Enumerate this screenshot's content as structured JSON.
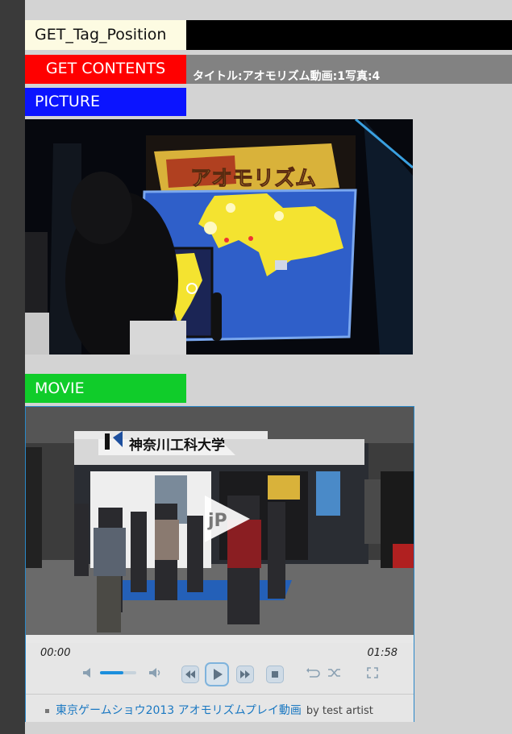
{
  "buttons": {
    "tag_position": "GET_Tag_Position",
    "get_contents": "GET CONTENTS",
    "picture": "PICTURE",
    "movie": "MOVIE"
  },
  "contents_title": "タイトル:アオモリズム動画:1写真:4",
  "player": {
    "time_current": "00:00",
    "time_total": "01:58",
    "volume_level": 0.65,
    "overlay_logo": "jP",
    "playlist": [
      {
        "title": "東京ゲームショウ2013 アオモリズムプレイ動画",
        "artist": "by test artist"
      }
    ]
  },
  "photo_sign_text": "アオモリズム",
  "video_sign_text": "神奈川工科大学",
  "colors": {
    "tag_bg": "#fdfbe2",
    "get_bg": "#ff0000",
    "picture_bg": "#0b14ff",
    "movie_bg": "#10cc2a",
    "accent": "#2a88c8"
  },
  "icons": [
    "volume-low-icon",
    "volume-high-icon",
    "rewind-icon",
    "play-icon",
    "fast-forward-icon",
    "stop-icon",
    "repeat-icon",
    "shuffle-icon",
    "fullscreen-icon"
  ]
}
